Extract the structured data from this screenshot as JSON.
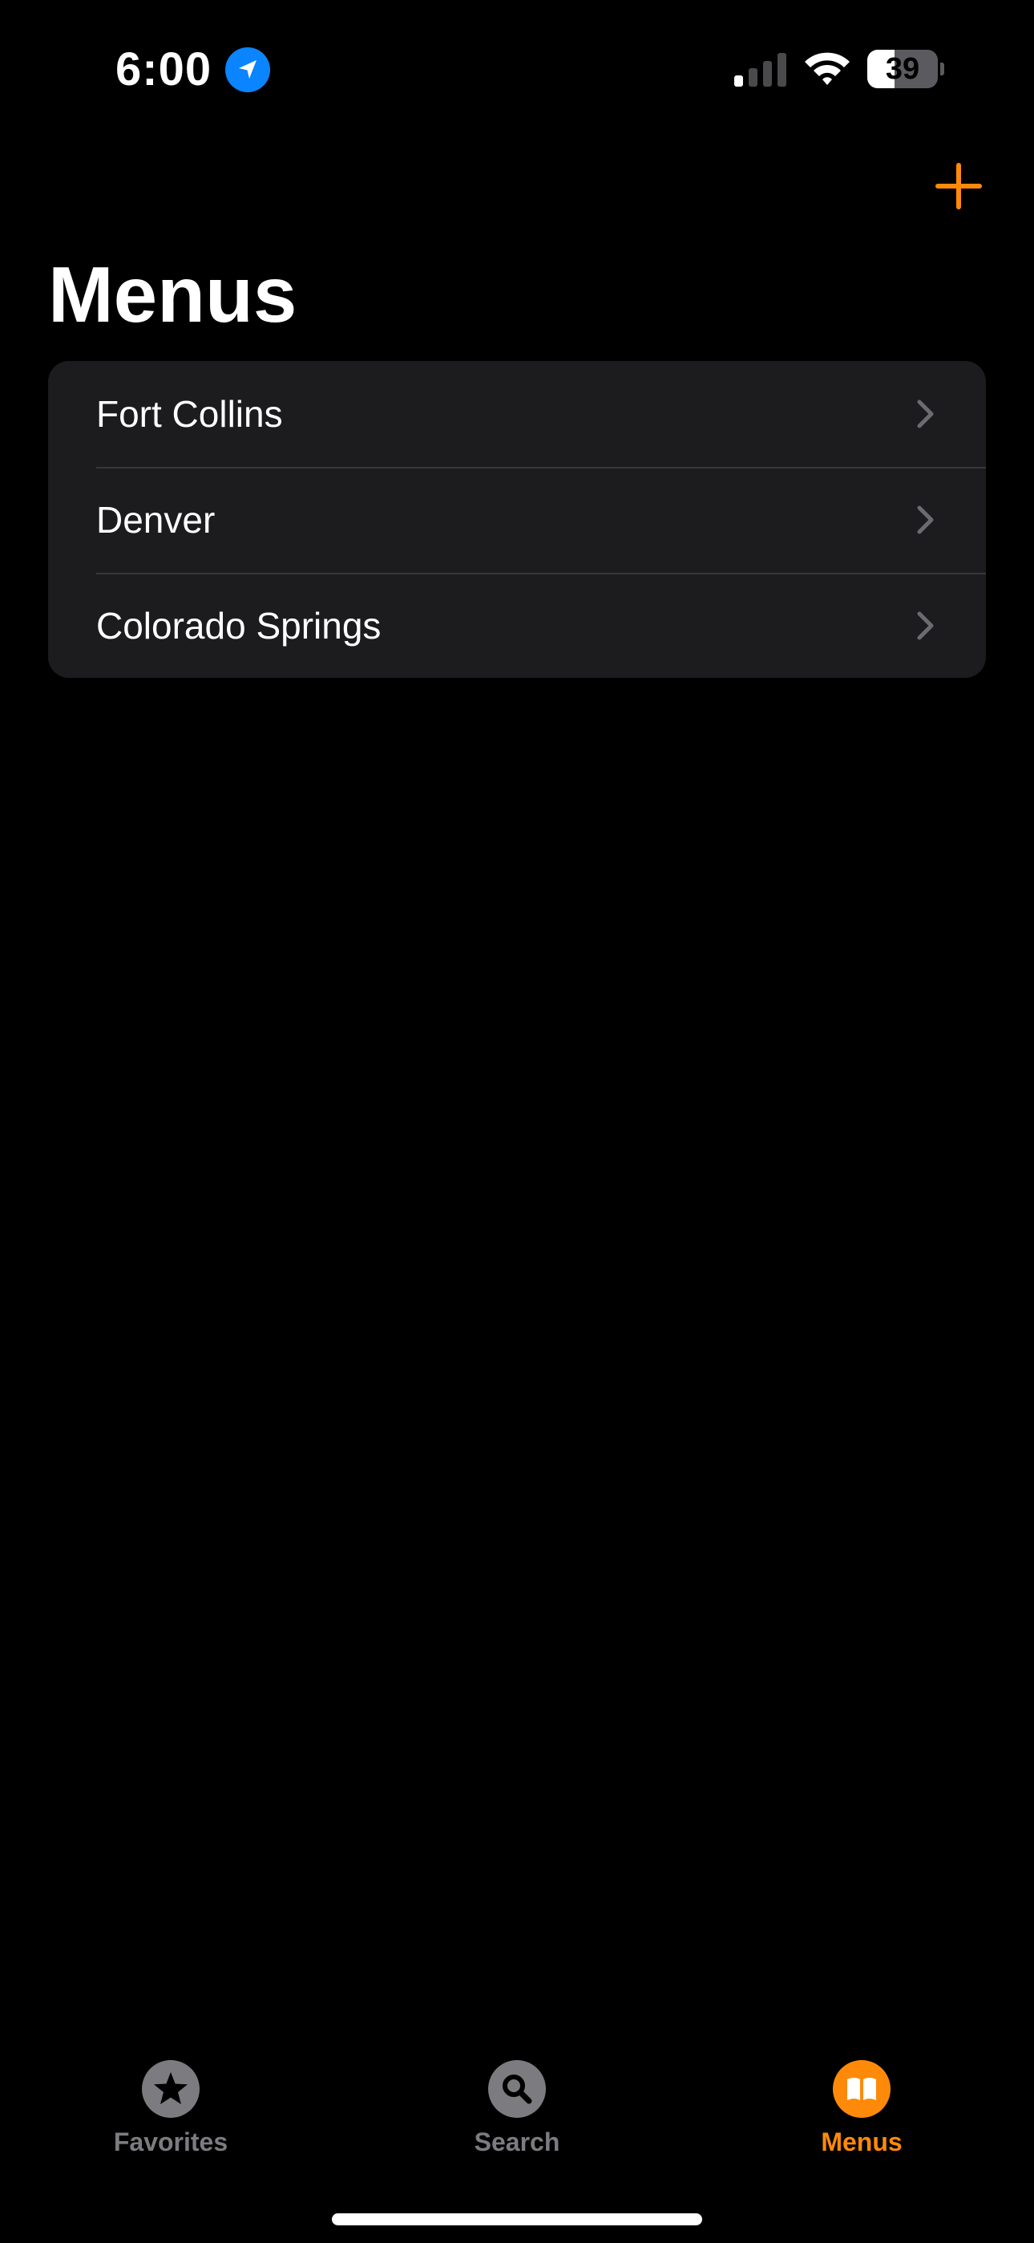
{
  "status_bar": {
    "time": "6:00",
    "battery_level": "39",
    "battery_fraction": 0.39,
    "signal_bars_active": 1,
    "signal_bars_total": 4,
    "location_icon": "location-arrow-icon",
    "wifi_icon": "wifi-icon"
  },
  "nav": {
    "add_icon": "plus-icon",
    "title": "Menus"
  },
  "menus": {
    "items": [
      {
        "label": "Fort Collins",
        "icon": "chevron-right-icon"
      },
      {
        "label": "Denver",
        "icon": "chevron-right-icon"
      },
      {
        "label": "Colorado Springs",
        "icon": "chevron-right-icon"
      }
    ]
  },
  "tab_bar": {
    "tabs": [
      {
        "label": "Favorites",
        "icon": "star-icon",
        "active": false
      },
      {
        "label": "Search",
        "icon": "magnifying-glass-icon",
        "active": false
      },
      {
        "label": "Menus",
        "icon": "book-icon",
        "active": true
      }
    ]
  },
  "colors": {
    "accent": "#ff8a0a",
    "background": "#000000",
    "list_background": "#1c1c1e",
    "inactive_tab": "#7c7c80",
    "location_blue": "#0a84ff"
  }
}
